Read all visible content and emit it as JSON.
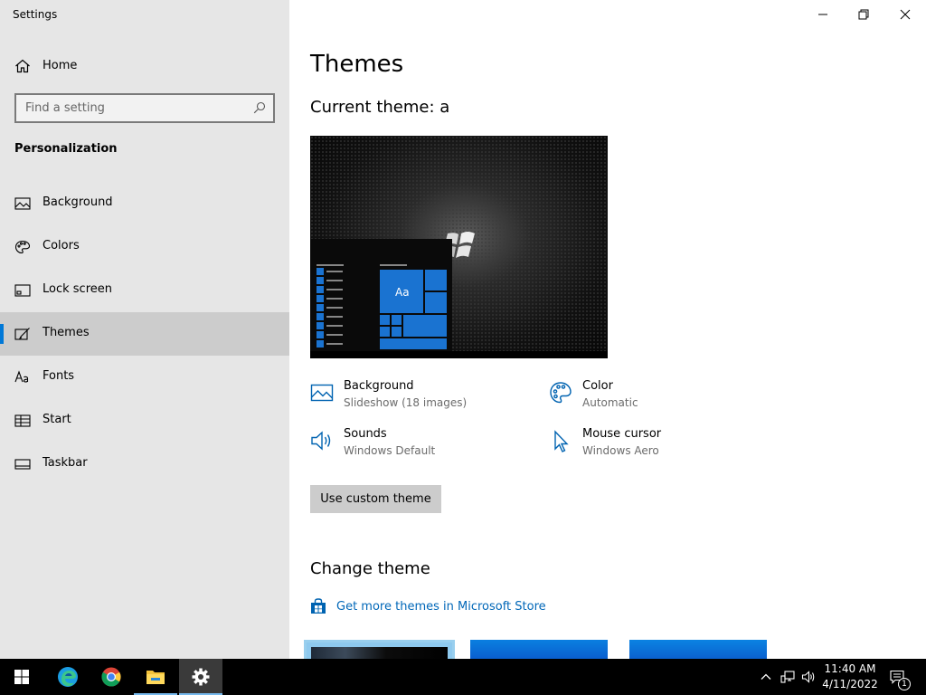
{
  "window": {
    "title": "Settings",
    "controls": [
      "minimize",
      "restore",
      "close"
    ]
  },
  "sidebar": {
    "home_label": "Home",
    "search_placeholder": "Find a setting",
    "section_title": "Personalization",
    "items": [
      {
        "label": "Background",
        "icon": "image-icon"
      },
      {
        "label": "Colors",
        "icon": "palette-icon"
      },
      {
        "label": "Lock screen",
        "icon": "lock-screen-icon"
      },
      {
        "label": "Themes",
        "icon": "themes-icon",
        "selected": true
      },
      {
        "label": "Fonts",
        "icon": "fonts-icon"
      },
      {
        "label": "Start",
        "icon": "start-icon"
      },
      {
        "label": "Taskbar",
        "icon": "taskbar-icon"
      }
    ]
  },
  "main": {
    "title": "Themes",
    "current_theme_label": "Current theme: a",
    "preview_tile_text": "Aa",
    "settings": [
      {
        "name": "Background",
        "value": "Slideshow (18 images)",
        "icon": "image-icon"
      },
      {
        "name": "Color",
        "value": "Automatic",
        "icon": "palette-icon"
      },
      {
        "name": "Sounds",
        "value": "Windows Default",
        "icon": "speaker-icon"
      },
      {
        "name": "Mouse cursor",
        "value": "Windows Aero",
        "icon": "cursor-icon"
      }
    ],
    "custom_button": "Use custom theme",
    "change_theme_title": "Change theme",
    "store_link": "Get more themes in Microsoft Store"
  },
  "taskbar": {
    "apps": [
      "start-icon",
      "edge-icon",
      "chrome-icon",
      "file-explorer-icon",
      "settings-icon"
    ],
    "clock_time": "11:40 AM",
    "clock_date": "4/11/2022",
    "notification_count": "1"
  },
  "colors": {
    "accent": "#0078d7",
    "sidebar_bg": "#e6e6e6",
    "selected_bg": "#cccccc",
    "link": "#0067b8"
  }
}
